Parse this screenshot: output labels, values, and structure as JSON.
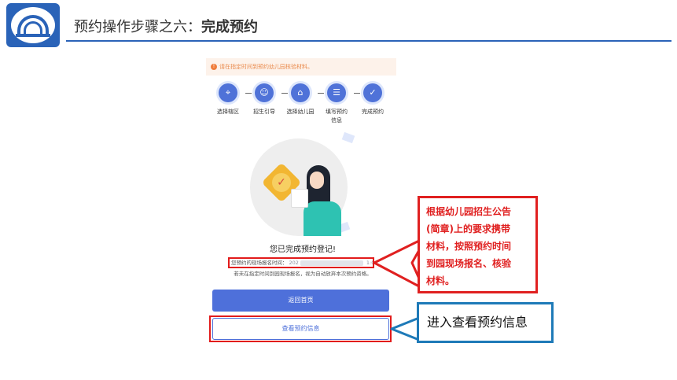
{
  "slide": {
    "title_prefix": "预约操作步骤之六：",
    "title_bold": "完成预约"
  },
  "app": {
    "notice": "请在指定时间到预约幼儿园核验材料。",
    "steps": [
      {
        "label": "选择辖区",
        "icon": "location-icon"
      },
      {
        "label": "招生引导",
        "icon": "person-icon"
      },
      {
        "label": "选择幼儿园",
        "icon": "school-icon"
      },
      {
        "label": "填写预约信息",
        "icon": "form-icon"
      },
      {
        "label": "完成预约",
        "icon": "check-icon"
      }
    ],
    "done_text": "您已完成预约登记!",
    "time_label": "您预约的现场报名时间：",
    "time_value_start": "202",
    "time_value_end": "1:00",
    "warn_text": "若未在指定时间到园现场报名，视为自动放弃本次预约资格。",
    "btn_home": "返回首页",
    "btn_view": "查看预约信息"
  },
  "callouts": {
    "red_lines": [
      "根据幼儿园招生公告",
      "(简章)上的要求携带",
      "材料，按照预约时间",
      "到园现场报名、核验",
      "材料。"
    ],
    "blue_text": "进入查看预约信息"
  },
  "colors": {
    "accent_blue": "#4e70da",
    "highlight_red": "#e02020",
    "callout_blue": "#1e7ab8",
    "notice_orange": "#e98a4c"
  }
}
